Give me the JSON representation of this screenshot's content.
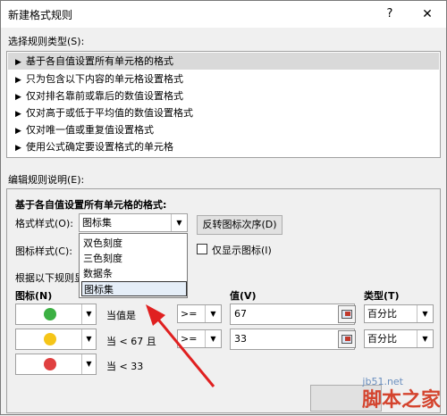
{
  "window": {
    "title": "新建格式规则",
    "help": "?",
    "close": "✕"
  },
  "select_rule_type": {
    "label": "选择规则类型(S):",
    "items": [
      "基于各自值设置所有单元格的格式",
      "只为包含以下内容的单元格设置格式",
      "仅对排名靠前或靠后的数值设置格式",
      "仅对高于或低于平均值的数值设置格式",
      "仅对唯一值或重复值设置格式",
      "使用公式确定要设置格式的单元格"
    ],
    "selected_index": 0
  },
  "edit_rule": {
    "label": "编辑规则说明(E):",
    "heading": "基于各自值设置所有单元格的格式:",
    "format_style_label": "格式样式(O):",
    "format_style_value": "图标集",
    "reverse_button": "反转图标次序(D)",
    "icon_style_label": "图标样式(C):",
    "show_icon_only_label": "仅显示图标(I)",
    "rules_label": "根据以下规则显",
    "dropdown_options": [
      "双色刻度",
      "三色刻度",
      "数据条",
      "图标集"
    ],
    "dropdown_selected": 3,
    "col_icon": "图标(N)",
    "col_value": "值(V)",
    "col_type": "类型(T)",
    "rows": [
      {
        "icon": "green-circle-icon",
        "color": "#3cb043",
        "desc": "当值是",
        "op": ">=",
        "value": "67",
        "type": "百分比"
      },
      {
        "icon": "yellow-circle-icon",
        "color": "#f5c518",
        "desc": "当 < 67 且",
        "op": ">=",
        "value": "33",
        "type": "百分比"
      },
      {
        "icon": "red-circle-icon",
        "color": "#e04040",
        "desc": "当 < 33"
      }
    ]
  },
  "watermark": {
    "site": "脚本之家",
    "url": "jb51.net"
  }
}
